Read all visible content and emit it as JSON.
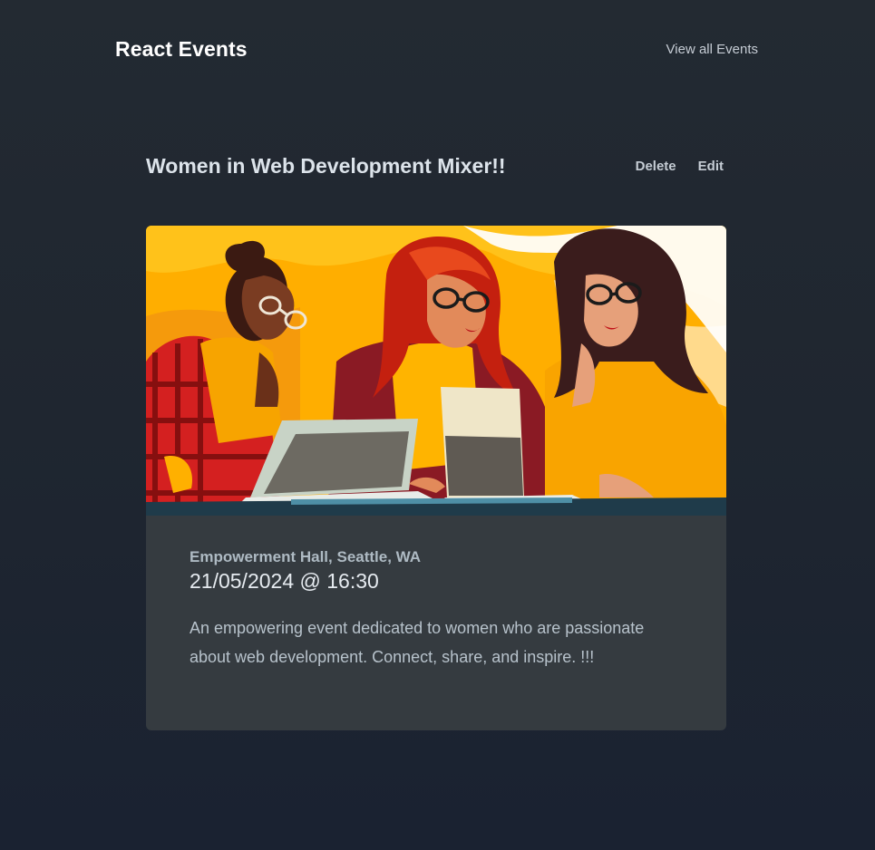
{
  "header": {
    "brand": "React Events",
    "nav_view_all": "View all Events"
  },
  "event": {
    "title": "Women in Web Development Mixer!!",
    "delete_label": "Delete",
    "edit_label": "Edit",
    "location": "Empowerment Hall, Seattle, WA",
    "datetime": "21/05/2024 @ 16:30",
    "description": "An empowering event dedicated to women who are passionate about web development. Connect, share, and inspire. !!!"
  },
  "colors": {
    "background": "#1f2630",
    "card": "#353b40",
    "accent_yellow": "#ffb000",
    "accent_orange": "#f7931e",
    "accent_red": "#c41e1e"
  }
}
